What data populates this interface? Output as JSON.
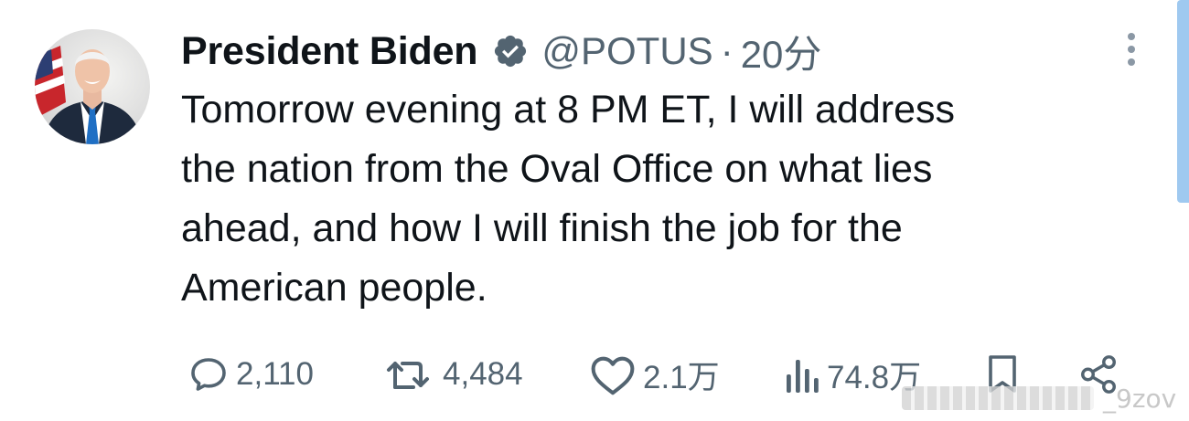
{
  "author": {
    "name": "President Biden",
    "verified": true,
    "handle": "@POTUS",
    "separator": "·",
    "time": "20分"
  },
  "tweet": {
    "lines": [
      "Tomorrow evening at 8 PM ET, I will address",
      "the nation from the Oval Office on what lies",
      "ahead, and how I will finish the job for the",
      "American people."
    ]
  },
  "actions": {
    "replies": "2,110",
    "retweets": "4,484",
    "likes": "2.1万",
    "views": "74.8万"
  },
  "watermark": {
    "text": "_9zov"
  },
  "colors": {
    "verified_badge": "#536471",
    "muted_text": "#536471",
    "scrollbar": "#9fc9f0"
  },
  "icons": {
    "reply": "speech-bubble-icon",
    "retweet": "retweet-icon",
    "like": "heart-icon",
    "views": "bar-chart-icon",
    "bookmark": "bookmark-icon",
    "share": "share-icon",
    "more": "more-vertical-icon"
  }
}
